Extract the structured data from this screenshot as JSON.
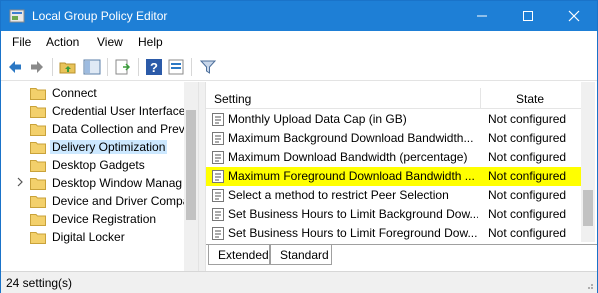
{
  "window": {
    "title": "Local Group Policy Editor",
    "accent": "#1e7fd6"
  },
  "menu": {
    "file": "File",
    "action": "Action",
    "view": "View",
    "help": "Help"
  },
  "toolbar": {
    "icons": [
      "back-arrow-icon",
      "forward-arrow-icon",
      "up-folder-icon",
      "show-hide-tree-icon",
      "export-list-icon",
      "help-icon",
      "properties-icon",
      "filter-icon"
    ]
  },
  "tree": {
    "items": [
      {
        "label": "Connect",
        "expandable": false
      },
      {
        "label": "Credential User Interface",
        "expandable": false
      },
      {
        "label": "Data Collection and Prev",
        "expandable": false
      },
      {
        "label": "Delivery Optimization",
        "expandable": false,
        "selected": true
      },
      {
        "label": "Desktop Gadgets",
        "expandable": false
      },
      {
        "label": "Desktop Window Manag",
        "expandable": true
      },
      {
        "label": "Device and Driver Compa",
        "expandable": false
      },
      {
        "label": "Device Registration",
        "expandable": false
      },
      {
        "label": "Digital Locker",
        "expandable": false
      }
    ]
  },
  "list": {
    "col_setting": "Setting",
    "col_state": "State",
    "rows": [
      {
        "name": "Monthly Upload Data Cap (in GB)",
        "state": "Not configured"
      },
      {
        "name": "Maximum Background Download Bandwidth...",
        "state": "Not configured"
      },
      {
        "name": "Maximum Download Bandwidth (percentage)",
        "state": "Not configured"
      },
      {
        "name": "Maximum Foreground Download Bandwidth ...",
        "state": "Not configured",
        "selected": true
      },
      {
        "name": "Select a method to restrict Peer Selection",
        "state": "Not configured"
      },
      {
        "name": "Set Business Hours to Limit Background Dow...",
        "state": "Not configured"
      },
      {
        "name": "Set Business Hours to Limit Foreground Dow...",
        "state": "Not configured"
      }
    ],
    "highlight_color": "#ffff00"
  },
  "tabs": {
    "extended": "Extended",
    "standard": "Standard"
  },
  "status": {
    "text": "24 setting(s)"
  }
}
